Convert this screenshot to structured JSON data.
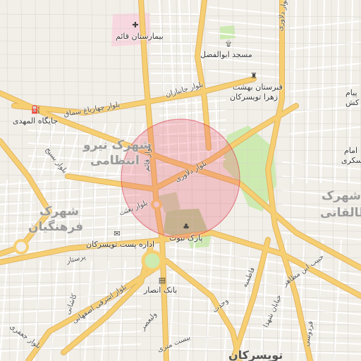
{
  "colors": {
    "background": "#f2efe9",
    "major_road": "#f7cf73",
    "minor_road": "#ffffff",
    "block_outline": "#d6d2cc",
    "park": "#cdebb0",
    "highlight_fill": "rgba(235,90,110,0.28)",
    "highlight_stroke": "rgba(220,60,80,0.55)"
  },
  "districts": [
    {
      "id": "niroo-1",
      "text": "شهرک نیرو"
    },
    {
      "id": "niroo-2",
      "text": "انتظامی"
    },
    {
      "id": "farhangian-1",
      "text": "شهرک"
    },
    {
      "id": "farhangian-2",
      "text": "فرهنگیان"
    },
    {
      "id": "taleghani-1",
      "text": "شهرک"
    },
    {
      "id": "taleghani-2",
      "text": "طالقانی"
    }
  ],
  "pois": [
    {
      "id": "hospital",
      "text": "بیمارستان قائم",
      "icon": "hospital-cross-icon",
      "glyph": "✚"
    },
    {
      "id": "mosque",
      "text": "مسجد ابوالفضل",
      "icon": "mosque-icon",
      "glyph": "۩"
    },
    {
      "id": "cemetery-1",
      "text": "قبرستان بهشت",
      "icon": "cemetery-icon",
      "glyph": "♜"
    },
    {
      "id": "cemetery-2",
      "text": "زهرا تویسرکان",
      "icon": "",
      "glyph": ""
    },
    {
      "id": "gas",
      "text": "جایگاه المهدی",
      "icon": "fuel-station-icon",
      "glyph": "⛽"
    },
    {
      "id": "post",
      "text": "اداره پست تویسرکان",
      "icon": "post-office-icon",
      "glyph": "✉"
    },
    {
      "id": "park",
      "text": "پارک نبوت",
      "icon": "park-tree-icon",
      "glyph": "♣"
    },
    {
      "id": "bank",
      "text": "بانک انصار",
      "icon": "bank-icon",
      "glyph": "▤"
    },
    {
      "id": "payam-1",
      "text": "پیام",
      "icon": "",
      "glyph": ""
    },
    {
      "id": "payam-2",
      "text": "کش",
      "icon": "",
      "glyph": ""
    },
    {
      "id": "imam-1",
      "text": "امام",
      "icon": "",
      "glyph": ""
    },
    {
      "id": "imam-2",
      "text": "سکری",
      "icon": "",
      "glyph": ""
    }
  ],
  "roads": [
    {
      "id": "janbazan",
      "text": "بلوار جانبازان"
    },
    {
      "id": "charbagh",
      "text": "بلوار چهارباغ سماق"
    },
    {
      "id": "basij",
      "text": "بلوار بسیج"
    },
    {
      "id": "ghaem",
      "text": "بلوار قائم"
    },
    {
      "id": "delavari-1",
      "text": "بلوار دلاوری"
    },
    {
      "id": "delavari-2",
      "text": "بلوار دلاوری"
    },
    {
      "id": "besat",
      "text": "بلوار بعثت"
    },
    {
      "id": "parastar",
      "text": "پرستار"
    },
    {
      "id": "ashrafi",
      "text": "بلوار اشرفی اصفهانی"
    },
    {
      "id": "kashani",
      "text": "کاشانی"
    },
    {
      "id": "valiasr",
      "text": "ولیعصر"
    },
    {
      "id": "vahdat",
      "text": "وحدت"
    },
    {
      "id": "fatemieh",
      "text": "فاطمیه"
    },
    {
      "id": "shohada",
      "text": "خیابان شهدا"
    },
    {
      "id": "habib",
      "text": "حبیب ابن مظاهر"
    },
    {
      "id": "ferdowsi",
      "text": "فردوسی"
    },
    {
      "id": "bist-metri",
      "text": "بیست متری"
    },
    {
      "id": "jafar",
      "text": "بلوار جعفری"
    },
    {
      "id": "city",
      "text": "تویسرکان"
    }
  ]
}
